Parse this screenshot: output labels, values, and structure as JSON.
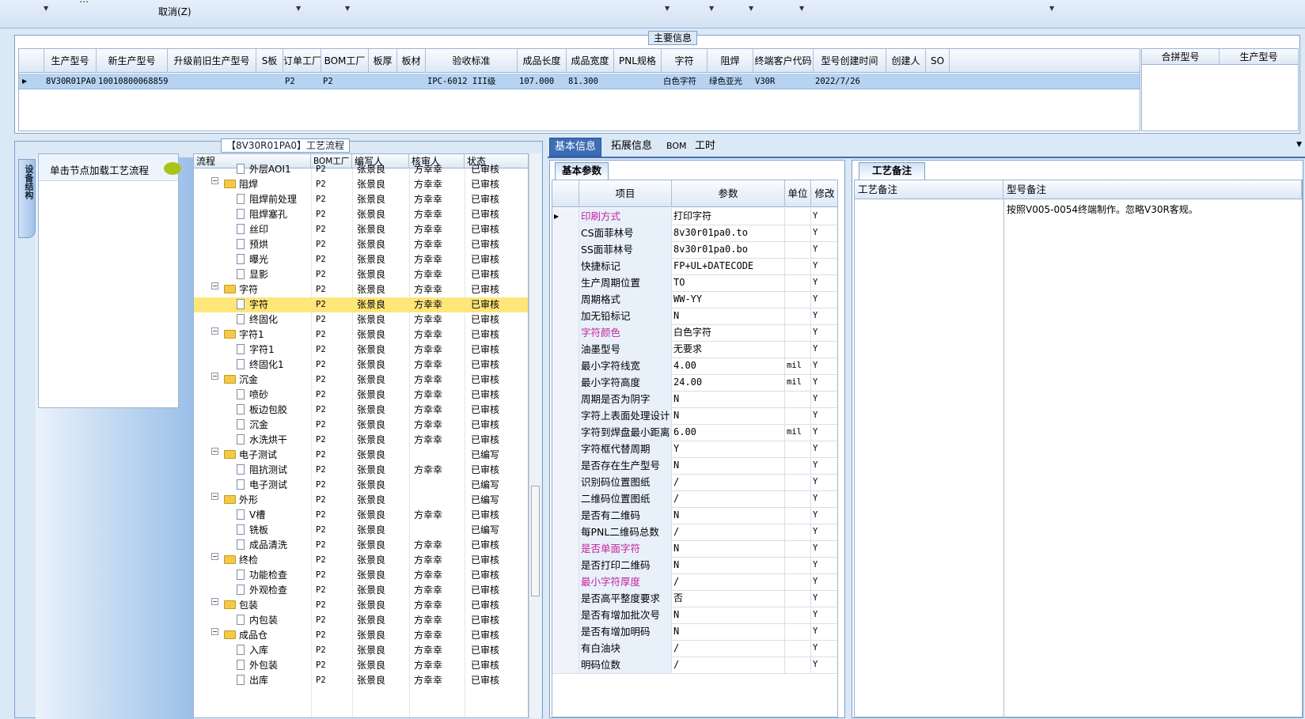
{
  "top": {
    "cancel_label": "取消(Z)",
    "partial_text": "…"
  },
  "main": {
    "title": "主要信息",
    "columns": [
      "生产型号",
      "新生产型号",
      "升级前旧生产型号",
      "S板",
      "订单工厂",
      "BOM工厂",
      "板厚",
      "板材",
      "验收标准",
      "成品长度",
      "成品宽度",
      "PNL规格",
      "字符",
      "阻焊",
      "终端客户代码",
      "型号创建时间",
      "创建人",
      "SO"
    ],
    "row": [
      "8V30R01PA0",
      "10010800068859",
      "",
      "",
      "P2",
      "P2",
      "",
      "",
      "IPC-6012 III级",
      "107.000",
      "81.300",
      "",
      "白色字符",
      "绿色亚光",
      "V30R",
      "2022/7/26",
      "",
      ""
    ],
    "merge_columns": [
      "合拼型号",
      "生产型号"
    ]
  },
  "flow": {
    "title": "【8V30R01PA0】工艺流程",
    "vertical_tab": "设备结构",
    "side_hint": "单击节点加载工艺流程",
    "columns": [
      "流程",
      "BOM工厂",
      "编写人",
      "核审人",
      "状态"
    ],
    "rows": [
      {
        "level": 2,
        "type": "doc",
        "name": "外层AOI1",
        "bom": "P2",
        "writer": "张景良",
        "reviewer": "方幸幸",
        "status": "已审核"
      },
      {
        "level": 1,
        "type": "folder",
        "name": "阻焊",
        "bom": "P2",
        "writer": "张景良",
        "reviewer": "方幸幸",
        "status": "已审核"
      },
      {
        "level": 2,
        "type": "doc",
        "name": "阻焊前处理",
        "bom": "P2",
        "writer": "张景良",
        "reviewer": "方幸幸",
        "status": "已审核"
      },
      {
        "level": 2,
        "type": "doc",
        "name": "阻焊塞孔",
        "bom": "P2",
        "writer": "张景良",
        "reviewer": "方幸幸",
        "status": "已审核"
      },
      {
        "level": 2,
        "type": "doc",
        "name": "丝印",
        "bom": "P2",
        "writer": "张景良",
        "reviewer": "方幸幸",
        "status": "已审核"
      },
      {
        "level": 2,
        "type": "doc",
        "name": "预烘",
        "bom": "P2",
        "writer": "张景良",
        "reviewer": "方幸幸",
        "status": "已审核"
      },
      {
        "level": 2,
        "type": "doc",
        "name": "曝光",
        "bom": "P2",
        "writer": "张景良",
        "reviewer": "方幸幸",
        "status": "已审核"
      },
      {
        "level": 2,
        "type": "doc",
        "name": "显影",
        "bom": "P2",
        "writer": "张景良",
        "reviewer": "方幸幸",
        "status": "已审核"
      },
      {
        "level": 1,
        "type": "folder",
        "name": "字符",
        "bom": "P2",
        "writer": "张景良",
        "reviewer": "方幸幸",
        "status": "已审核"
      },
      {
        "level": 2,
        "type": "doc",
        "name": "字符",
        "bom": "P2",
        "writer": "张景良",
        "reviewer": "方幸幸",
        "status": "已审核",
        "selected": true
      },
      {
        "level": 2,
        "type": "doc",
        "name": "终固化",
        "bom": "P2",
        "writer": "张景良",
        "reviewer": "方幸幸",
        "status": "已审核"
      },
      {
        "level": 1,
        "type": "folder",
        "name": "字符1",
        "bom": "P2",
        "writer": "张景良",
        "reviewer": "方幸幸",
        "status": "已审核"
      },
      {
        "level": 2,
        "type": "doc",
        "name": "字符1",
        "bom": "P2",
        "writer": "张景良",
        "reviewer": "方幸幸",
        "status": "已审核"
      },
      {
        "level": 2,
        "type": "doc",
        "name": "终固化1",
        "bom": "P2",
        "writer": "张景良",
        "reviewer": "方幸幸",
        "status": "已审核"
      },
      {
        "level": 1,
        "type": "folder",
        "name": "沉金",
        "bom": "P2",
        "writer": "张景良",
        "reviewer": "方幸幸",
        "status": "已审核"
      },
      {
        "level": 2,
        "type": "doc",
        "name": "喷砂",
        "bom": "P2",
        "writer": "张景良",
        "reviewer": "方幸幸",
        "status": "已审核"
      },
      {
        "level": 2,
        "type": "doc",
        "name": "板边包胶",
        "bom": "P2",
        "writer": "张景良",
        "reviewer": "方幸幸",
        "status": "已审核"
      },
      {
        "level": 2,
        "type": "doc",
        "name": "沉金",
        "bom": "P2",
        "writer": "张景良",
        "reviewer": "方幸幸",
        "status": "已审核"
      },
      {
        "level": 2,
        "type": "doc",
        "name": "水洗烘干",
        "bom": "P2",
        "writer": "张景良",
        "reviewer": "方幸幸",
        "status": "已审核"
      },
      {
        "level": 1,
        "type": "folder",
        "name": "电子测试",
        "bom": "P2",
        "writer": "张景良",
        "reviewer": "",
        "status": "已编写"
      },
      {
        "level": 2,
        "type": "doc",
        "name": "阻抗测试",
        "bom": "P2",
        "writer": "张景良",
        "reviewer": "方幸幸",
        "status": "已审核"
      },
      {
        "level": 2,
        "type": "doc",
        "name": "电子测试",
        "bom": "P2",
        "writer": "张景良",
        "reviewer": "",
        "status": "已编写"
      },
      {
        "level": 1,
        "type": "folder",
        "name": "外形",
        "bom": "P2",
        "writer": "张景良",
        "reviewer": "",
        "status": "已编写"
      },
      {
        "level": 2,
        "type": "doc",
        "name": "V槽",
        "bom": "P2",
        "writer": "张景良",
        "reviewer": "方幸幸",
        "status": "已审核"
      },
      {
        "level": 2,
        "type": "doc",
        "name": "铣板",
        "bom": "P2",
        "writer": "张景良",
        "reviewer": "",
        "status": "已编写"
      },
      {
        "level": 2,
        "type": "doc",
        "name": "成品清洗",
        "bom": "P2",
        "writer": "张景良",
        "reviewer": "方幸幸",
        "status": "已审核"
      },
      {
        "level": 1,
        "type": "folder",
        "name": "终检",
        "bom": "P2",
        "writer": "张景良",
        "reviewer": "方幸幸",
        "status": "已审核"
      },
      {
        "level": 2,
        "type": "doc",
        "name": "功能检查",
        "bom": "P2",
        "writer": "张景良",
        "reviewer": "方幸幸",
        "status": "已审核"
      },
      {
        "level": 2,
        "type": "doc",
        "name": "外观检查",
        "bom": "P2",
        "writer": "张景良",
        "reviewer": "方幸幸",
        "status": "已审核"
      },
      {
        "level": 1,
        "type": "folder",
        "name": "包装",
        "bom": "P2",
        "writer": "张景良",
        "reviewer": "方幸幸",
        "status": "已审核"
      },
      {
        "level": 2,
        "type": "doc",
        "name": "内包装",
        "bom": "P2",
        "writer": "张景良",
        "reviewer": "方幸幸",
        "status": "已审核"
      },
      {
        "level": 1,
        "type": "folder",
        "name": "成品仓",
        "bom": "P2",
        "writer": "张景良",
        "reviewer": "方幸幸",
        "status": "已审核"
      },
      {
        "level": 2,
        "type": "doc",
        "name": "入库",
        "bom": "P2",
        "writer": "张景良",
        "reviewer": "方幸幸",
        "status": "已审核"
      },
      {
        "level": 2,
        "type": "doc",
        "name": "外包装",
        "bom": "P2",
        "writer": "张景良",
        "reviewer": "方幸幸",
        "status": "已审核"
      },
      {
        "level": 2,
        "type": "doc",
        "name": "出库",
        "bom": "P2",
        "writer": "张景良",
        "reviewer": "方幸幸",
        "status": "已审核"
      }
    ]
  },
  "tabs": [
    "基本信息",
    "拓展信息",
    "BOM",
    "工时"
  ],
  "basic": {
    "section_title": "基本参数",
    "columns": [
      "项目",
      "参数",
      "单位",
      "修改"
    ],
    "rows": [
      {
        "name": "印刷方式",
        "value": "打印字符",
        "unit": "",
        "mod": "Y",
        "pink": true,
        "current": true
      },
      {
        "name": "CS面菲林号",
        "value": "8v30r01pa0.to",
        "unit": "",
        "mod": "Y"
      },
      {
        "name": "SS面菲林号",
        "value": "8v30r01pa0.bo",
        "unit": "",
        "mod": "Y"
      },
      {
        "name": "快捷标记",
        "value": "FP+UL+DATECODE",
        "unit": "",
        "mod": "Y"
      },
      {
        "name": "生产周期位置",
        "value": "TO",
        "unit": "",
        "mod": "Y"
      },
      {
        "name": "周期格式",
        "value": "WW-YY",
        "unit": "",
        "mod": "Y"
      },
      {
        "name": "加无铅标记",
        "value": "N",
        "unit": "",
        "mod": "Y"
      },
      {
        "name": "字符颜色",
        "value": "白色字符",
        "unit": "",
        "mod": "Y",
        "pink": true
      },
      {
        "name": "油墨型号",
        "value": "无要求",
        "unit": "",
        "mod": "Y"
      },
      {
        "name": "最小字符线宽",
        "value": "4.00",
        "unit": "mil",
        "mod": "Y"
      },
      {
        "name": "最小字符高度",
        "value": "24.00",
        "unit": "mil",
        "mod": "Y"
      },
      {
        "name": "周期是否为阴字",
        "value": "N",
        "unit": "",
        "mod": "Y"
      },
      {
        "name": "字符上表面处理设计",
        "value": "N",
        "unit": "",
        "mod": "Y"
      },
      {
        "name": "字符到焊盘最小距离",
        "value": "6.00",
        "unit": "mil",
        "mod": "Y"
      },
      {
        "name": "字符框代替周期",
        "value": "Y",
        "unit": "",
        "mod": "Y"
      },
      {
        "name": "是否存在生产型号",
        "value": "N",
        "unit": "",
        "mod": "Y"
      },
      {
        "name": "识别码位置图纸",
        "value": "/",
        "unit": "",
        "mod": "Y"
      },
      {
        "name": "二维码位置图纸",
        "value": "/",
        "unit": "",
        "mod": "Y"
      },
      {
        "name": "是否有二维码",
        "value": "N",
        "unit": "",
        "mod": "Y"
      },
      {
        "name": "每PNL二维码总数",
        "value": "/",
        "unit": "",
        "mod": "Y"
      },
      {
        "name": "是否单面字符",
        "value": "N",
        "unit": "",
        "mod": "Y",
        "pink": true
      },
      {
        "name": "是否打印二维码",
        "value": "N",
        "unit": "",
        "mod": "Y"
      },
      {
        "name": "最小字符厚度",
        "value": "/",
        "unit": "",
        "mod": "Y",
        "pink": true
      },
      {
        "name": "是否高平整度要求",
        "value": "否",
        "unit": "",
        "mod": "Y"
      },
      {
        "name": "是否有增加批次号",
        "value": "N",
        "unit": "",
        "mod": "Y"
      },
      {
        "name": "是否有增加明码",
        "value": "N",
        "unit": "",
        "mod": "Y"
      },
      {
        "name": "有白油块",
        "value": "/",
        "unit": "",
        "mod": "Y"
      },
      {
        "name": "明码位数",
        "value": "/",
        "unit": "",
        "mod": "Y"
      }
    ]
  },
  "notes": {
    "section_title": "工艺备注",
    "col_process": "工艺备注",
    "col_model": "型号备注",
    "model_note": "按照V005-0054终端制作。忽略V30R客规。"
  }
}
